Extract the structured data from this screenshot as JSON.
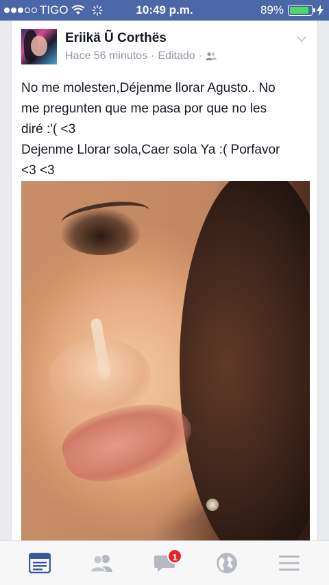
{
  "status_bar": {
    "carrier": "TIGO",
    "time": "10:49 p.m.",
    "battery_percent": "89%",
    "battery_level": 0.89,
    "signal_bars_filled": 3,
    "signal_bars_total": 5
  },
  "post": {
    "author": "Eriikä Ũ Corthës",
    "timestamp": "Hace 56 minutos",
    "separator": "·",
    "edited_label": "Editado",
    "text_lines": [
      "No me molesten,Déjenme llorar Agusto.. No",
      "me pregunten que me pasa por que no les",
      "diré :'( <3",
      "Dejenme Llorar sola,Caer sola Ya :( Porfavor",
      "<3 <3"
    ]
  },
  "tab_bar": {
    "items": [
      {
        "name": "news-feed",
        "active": true
      },
      {
        "name": "friend-requests",
        "active": false
      },
      {
        "name": "messages",
        "active": false,
        "badge": "1"
      },
      {
        "name": "notifications",
        "active": false
      },
      {
        "name": "more",
        "active": false
      }
    ]
  },
  "colors": {
    "status_bar": "#4a68a8",
    "facebook_blue": "#3b5998",
    "inactive_icon": "#b5b9c2",
    "badge": "#e0272a"
  }
}
